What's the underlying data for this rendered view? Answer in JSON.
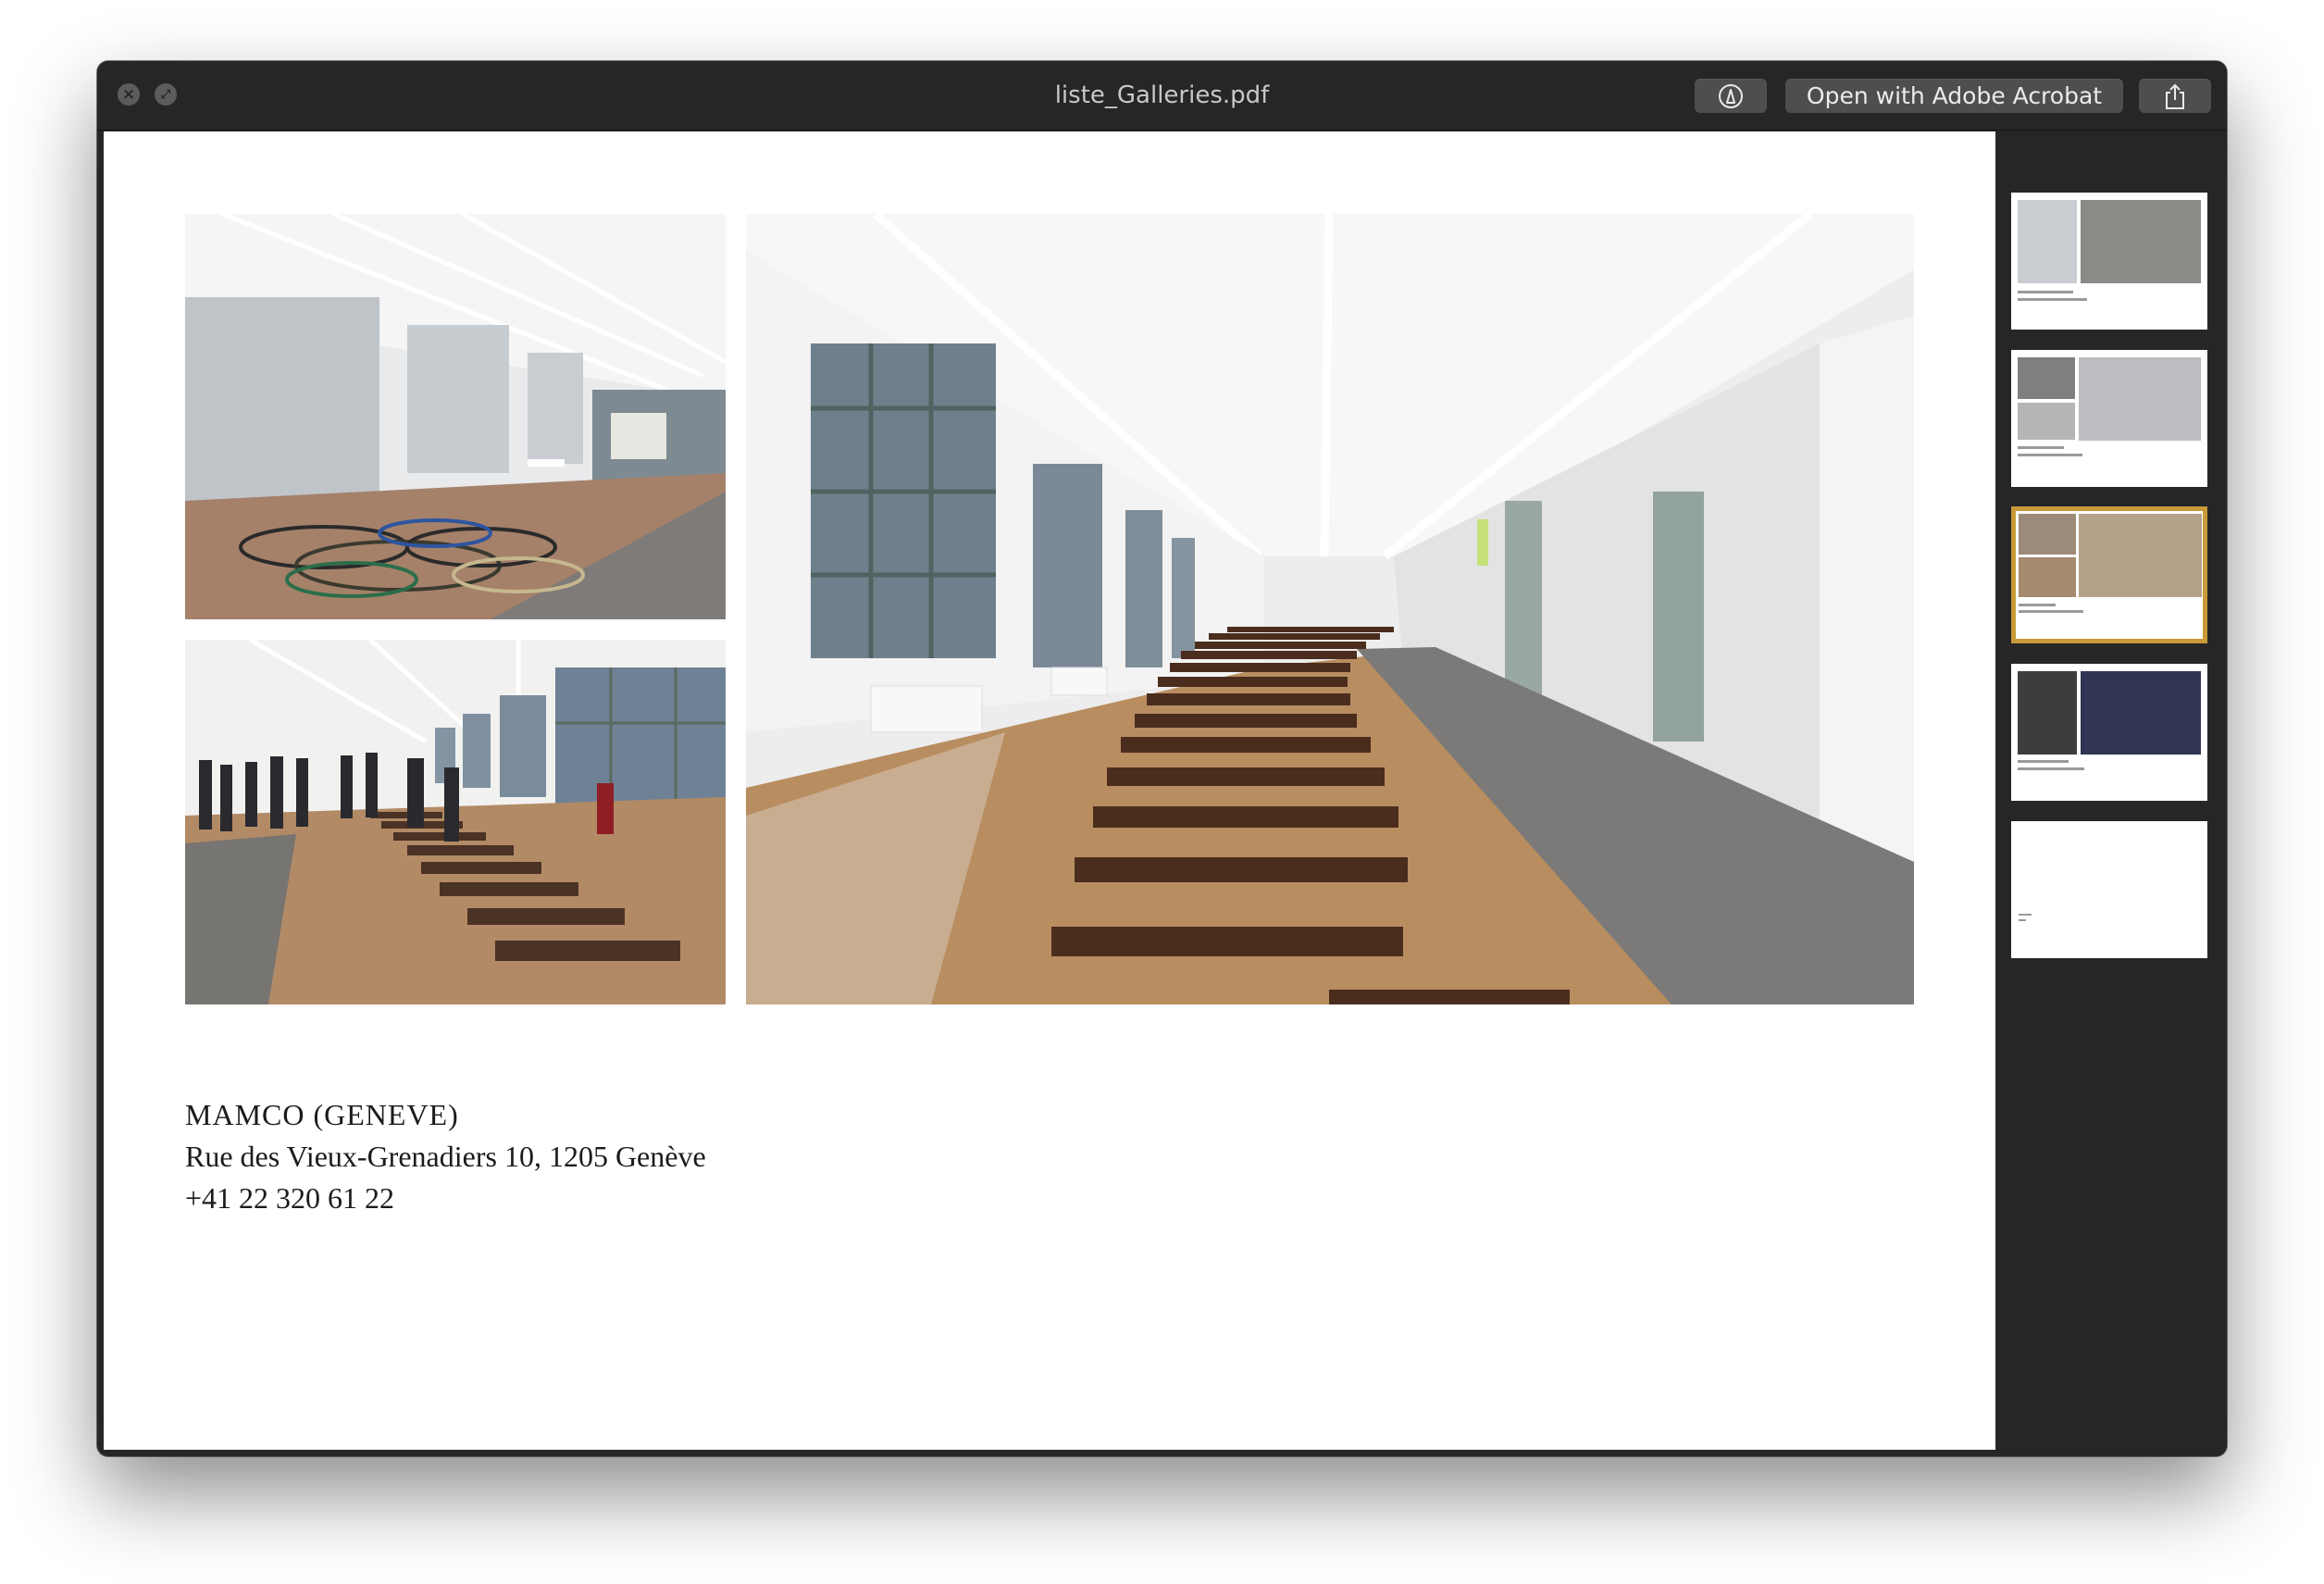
{
  "window": {
    "title": "liste_Galleries.pdf",
    "open_with_label": "Open with Adobe Acrobat"
  },
  "icons": {
    "close": "close-icon",
    "fullscreen": "fullscreen-icon",
    "markup": "markup-pen-icon",
    "share": "share-icon"
  },
  "colors": {
    "window_bg": "#262626",
    "selected_thumbnail_border": "#c99a3a"
  },
  "page": {
    "name": "MAMCO (GENEVE)",
    "address": "Rue des Vieux-Grenadiers 10, 1205 Genève",
    "phone": "+41 22 320 61 22"
  },
  "thumbnails": {
    "count": 5,
    "selected_index": 2
  }
}
